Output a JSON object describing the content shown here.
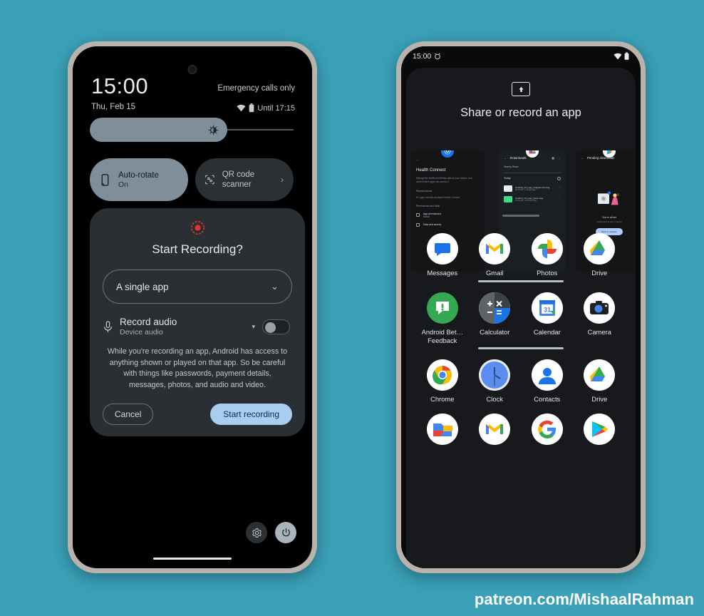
{
  "background_color": "#3aa1b8",
  "watermark": "patreon.com/MishaalRahman",
  "left_phone": {
    "quick_settings": {
      "clock": "15:00",
      "date": "Thu, Feb 15",
      "carrier": "Emergency calls only",
      "status_until": "Until 17:15",
      "brightness_icon": "brightness-icon",
      "tiles": [
        {
          "label": "Auto-rotate",
          "sub": "On",
          "state": "on",
          "icon": "auto-rotate-icon"
        },
        {
          "label": "QR code scanner",
          "sub": "",
          "state": "off",
          "icon": "qr-code-icon",
          "chevron": "›"
        }
      ],
      "footer": {
        "settings_icon": "gear-icon",
        "power_icon": "power-icon"
      }
    },
    "dialog": {
      "icon": "screen-record-icon",
      "accent_color": "#e8332a",
      "title": "Start Recording?",
      "select_value": "A single app",
      "select_chevron": "⌄",
      "audio": {
        "icon": "microphone-icon",
        "title": "Record audio",
        "subtitle": "Device audio",
        "caret": "▾",
        "toggle_state": "off"
      },
      "description": "While you're recording an app, Android has access to anything shown or played on that app. So be careful with things like passwords, payment details, messages, photos, and audio and video.",
      "cancel_label": "Cancel",
      "start_label": "Start recording",
      "start_button_color": "#a8cdf0"
    }
  },
  "right_phone": {
    "status_bar": {
      "time": "15:00",
      "alarm_icon": "alarm-icon",
      "wifi_icon": "wifi-icon",
      "battery_icon": "battery-icon"
    },
    "sheet": {
      "share_icon": "share-screen-icon",
      "title": "Share or record an app",
      "recents": [
        {
          "badge_icon": "settings-app-icon",
          "header": "Health Connect",
          "body_lines": [
            "Manage the health and fitness data on your device, and control which apps can access it",
            "Recent access",
            "No apps recently accessed Health Connect",
            "Permissions and data"
          ],
          "list_items": [
            {
              "label": "App permissions",
              "sub": "None",
              "icon": "shield-icon"
            },
            {
              "label": "Data and access",
              "sub": "",
              "icon": "data-icon"
            }
          ]
        },
        {
          "badge_icon": "files-app-icon",
          "header": "Downloads",
          "subheader": "Nearby Share",
          "section": "Today",
          "back_icon": "back-arrow-icon",
          "grid_icon": "grid-view-icon",
          "overflow_icon": "more-vert-icon",
          "files": [
            {
              "name": "Android_14_logo_cropped-min.png",
              "meta": "38.16 kB • a minute ago"
            },
            {
              "name": "Android_14_logo_green.png",
              "meta": "163.9 kB • 4 minutes ago"
            }
          ]
        },
        {
          "badge_icon": "play-store-icon",
          "header": "Pending downloads",
          "back_icon": "back-arrow-icon",
          "empty_title": "You're all set",
          "empty_sub": "Check back to see or cancel",
          "empty_button": "Back to updates"
        }
      ]
    },
    "app_grid": {
      "rows": [
        [
          {
            "name": "Messages",
            "icon": "messages-app-icon"
          },
          {
            "name": "Gmail",
            "icon": "gmail-app-icon"
          },
          {
            "name": "Photos",
            "icon": "photos-app-icon"
          },
          {
            "name": "Drive",
            "icon": "drive-app-icon"
          }
        ],
        [
          {
            "name": "Android Bet… Feedback",
            "icon": "android-beta-feedback-icon"
          },
          {
            "name": "Calculator",
            "icon": "calculator-app-icon"
          },
          {
            "name": "Calendar",
            "icon": "calendar-app-icon"
          },
          {
            "name": "Camera",
            "icon": "camera-app-icon"
          }
        ],
        [
          {
            "name": "Chrome",
            "icon": "chrome-app-icon"
          },
          {
            "name": "Clock",
            "icon": "clock-app-icon"
          },
          {
            "name": "Contacts",
            "icon": "contacts-app-icon"
          },
          {
            "name": "Drive",
            "icon": "drive-app-icon"
          }
        ],
        [
          {
            "name": "",
            "icon": "files-app-icon"
          },
          {
            "name": "",
            "icon": "gmail-app-icon"
          },
          {
            "name": "",
            "icon": "google-app-icon"
          },
          {
            "name": "",
            "icon": "play-store-icon"
          }
        ]
      ]
    }
  }
}
